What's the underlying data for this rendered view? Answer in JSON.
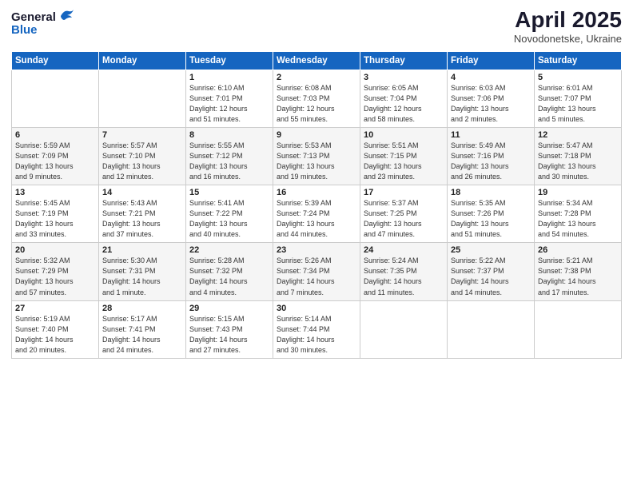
{
  "header": {
    "logo_general": "General",
    "logo_blue": "Blue",
    "title": "April 2025",
    "subtitle": "Novodonetske, Ukraine"
  },
  "weekdays": [
    "Sunday",
    "Monday",
    "Tuesday",
    "Wednesday",
    "Thursday",
    "Friday",
    "Saturday"
  ],
  "weeks": [
    [
      {
        "day": "",
        "info": ""
      },
      {
        "day": "",
        "info": ""
      },
      {
        "day": "1",
        "info": "Sunrise: 6:10 AM\nSunset: 7:01 PM\nDaylight: 12 hours\nand 51 minutes."
      },
      {
        "day": "2",
        "info": "Sunrise: 6:08 AM\nSunset: 7:03 PM\nDaylight: 12 hours\nand 55 minutes."
      },
      {
        "day": "3",
        "info": "Sunrise: 6:05 AM\nSunset: 7:04 PM\nDaylight: 12 hours\nand 58 minutes."
      },
      {
        "day": "4",
        "info": "Sunrise: 6:03 AM\nSunset: 7:06 PM\nDaylight: 13 hours\nand 2 minutes."
      },
      {
        "day": "5",
        "info": "Sunrise: 6:01 AM\nSunset: 7:07 PM\nDaylight: 13 hours\nand 5 minutes."
      }
    ],
    [
      {
        "day": "6",
        "info": "Sunrise: 5:59 AM\nSunset: 7:09 PM\nDaylight: 13 hours\nand 9 minutes."
      },
      {
        "day": "7",
        "info": "Sunrise: 5:57 AM\nSunset: 7:10 PM\nDaylight: 13 hours\nand 12 minutes."
      },
      {
        "day": "8",
        "info": "Sunrise: 5:55 AM\nSunset: 7:12 PM\nDaylight: 13 hours\nand 16 minutes."
      },
      {
        "day": "9",
        "info": "Sunrise: 5:53 AM\nSunset: 7:13 PM\nDaylight: 13 hours\nand 19 minutes."
      },
      {
        "day": "10",
        "info": "Sunrise: 5:51 AM\nSunset: 7:15 PM\nDaylight: 13 hours\nand 23 minutes."
      },
      {
        "day": "11",
        "info": "Sunrise: 5:49 AM\nSunset: 7:16 PM\nDaylight: 13 hours\nand 26 minutes."
      },
      {
        "day": "12",
        "info": "Sunrise: 5:47 AM\nSunset: 7:18 PM\nDaylight: 13 hours\nand 30 minutes."
      }
    ],
    [
      {
        "day": "13",
        "info": "Sunrise: 5:45 AM\nSunset: 7:19 PM\nDaylight: 13 hours\nand 33 minutes."
      },
      {
        "day": "14",
        "info": "Sunrise: 5:43 AM\nSunset: 7:21 PM\nDaylight: 13 hours\nand 37 minutes."
      },
      {
        "day": "15",
        "info": "Sunrise: 5:41 AM\nSunset: 7:22 PM\nDaylight: 13 hours\nand 40 minutes."
      },
      {
        "day": "16",
        "info": "Sunrise: 5:39 AM\nSunset: 7:24 PM\nDaylight: 13 hours\nand 44 minutes."
      },
      {
        "day": "17",
        "info": "Sunrise: 5:37 AM\nSunset: 7:25 PM\nDaylight: 13 hours\nand 47 minutes."
      },
      {
        "day": "18",
        "info": "Sunrise: 5:35 AM\nSunset: 7:26 PM\nDaylight: 13 hours\nand 51 minutes."
      },
      {
        "day": "19",
        "info": "Sunrise: 5:34 AM\nSunset: 7:28 PM\nDaylight: 13 hours\nand 54 minutes."
      }
    ],
    [
      {
        "day": "20",
        "info": "Sunrise: 5:32 AM\nSunset: 7:29 PM\nDaylight: 13 hours\nand 57 minutes."
      },
      {
        "day": "21",
        "info": "Sunrise: 5:30 AM\nSunset: 7:31 PM\nDaylight: 14 hours\nand 1 minute."
      },
      {
        "day": "22",
        "info": "Sunrise: 5:28 AM\nSunset: 7:32 PM\nDaylight: 14 hours\nand 4 minutes."
      },
      {
        "day": "23",
        "info": "Sunrise: 5:26 AM\nSunset: 7:34 PM\nDaylight: 14 hours\nand 7 minutes."
      },
      {
        "day": "24",
        "info": "Sunrise: 5:24 AM\nSunset: 7:35 PM\nDaylight: 14 hours\nand 11 minutes."
      },
      {
        "day": "25",
        "info": "Sunrise: 5:22 AM\nSunset: 7:37 PM\nDaylight: 14 hours\nand 14 minutes."
      },
      {
        "day": "26",
        "info": "Sunrise: 5:21 AM\nSunset: 7:38 PM\nDaylight: 14 hours\nand 17 minutes."
      }
    ],
    [
      {
        "day": "27",
        "info": "Sunrise: 5:19 AM\nSunset: 7:40 PM\nDaylight: 14 hours\nand 20 minutes."
      },
      {
        "day": "28",
        "info": "Sunrise: 5:17 AM\nSunset: 7:41 PM\nDaylight: 14 hours\nand 24 minutes."
      },
      {
        "day": "29",
        "info": "Sunrise: 5:15 AM\nSunset: 7:43 PM\nDaylight: 14 hours\nand 27 minutes."
      },
      {
        "day": "30",
        "info": "Sunrise: 5:14 AM\nSunset: 7:44 PM\nDaylight: 14 hours\nand 30 minutes."
      },
      {
        "day": "",
        "info": ""
      },
      {
        "day": "",
        "info": ""
      },
      {
        "day": "",
        "info": ""
      }
    ]
  ]
}
